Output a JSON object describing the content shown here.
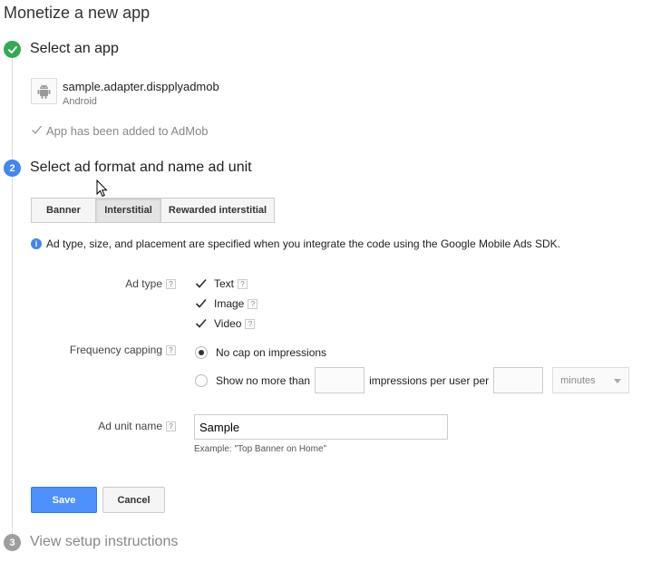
{
  "page": {
    "title": "Monetize a new app"
  },
  "steps": {
    "step1": {
      "title": "Select an app",
      "app": {
        "name": "sample.adapter.dispplyadmob",
        "platform": "Android"
      },
      "added_message": "App has been added to AdMob"
    },
    "step2": {
      "number": "2",
      "title": "Select ad format and name ad unit",
      "tabs": [
        {
          "label": "Banner"
        },
        {
          "label": "Interstitial",
          "active": true
        },
        {
          "label": "Rewarded interstitial"
        }
      ],
      "info": "Ad type, size, and placement are specified when you integrate the code using the Google Mobile Ads SDK.",
      "form": {
        "help_glyph": "?",
        "ad_type": {
          "label": "Ad type",
          "options": [
            {
              "label": "Text",
              "checked": true
            },
            {
              "label": "Image",
              "checked": true
            },
            {
              "label": "Video",
              "checked": true
            }
          ]
        },
        "frequency_capping": {
          "label": "Frequency capping",
          "option_none": "No cap on impressions",
          "option_limit_prefix": "Show no more than",
          "option_limit_middle": "impressions per user per",
          "impressions_value": "",
          "period_value": "",
          "unit_selected": "minutes",
          "selected": "none"
        },
        "ad_unit_name": {
          "label": "Ad unit name",
          "value": "Sample",
          "hint": "Example: \"Top Banner on Home\""
        }
      },
      "buttons": {
        "save": "Save",
        "cancel": "Cancel"
      }
    },
    "step3": {
      "number": "3",
      "title": "View setup instructions"
    }
  },
  "colors": {
    "success": "#34a853",
    "accent": "#4285f4",
    "primary_button": "#4d90fe",
    "disabled": "#9e9e9e"
  },
  "icons": [
    "check-circle-icon",
    "android-icon",
    "check-icon",
    "info-icon",
    "help-icon",
    "checkbox-checked-icon",
    "chevron-down-icon",
    "mouse-cursor-icon"
  ]
}
